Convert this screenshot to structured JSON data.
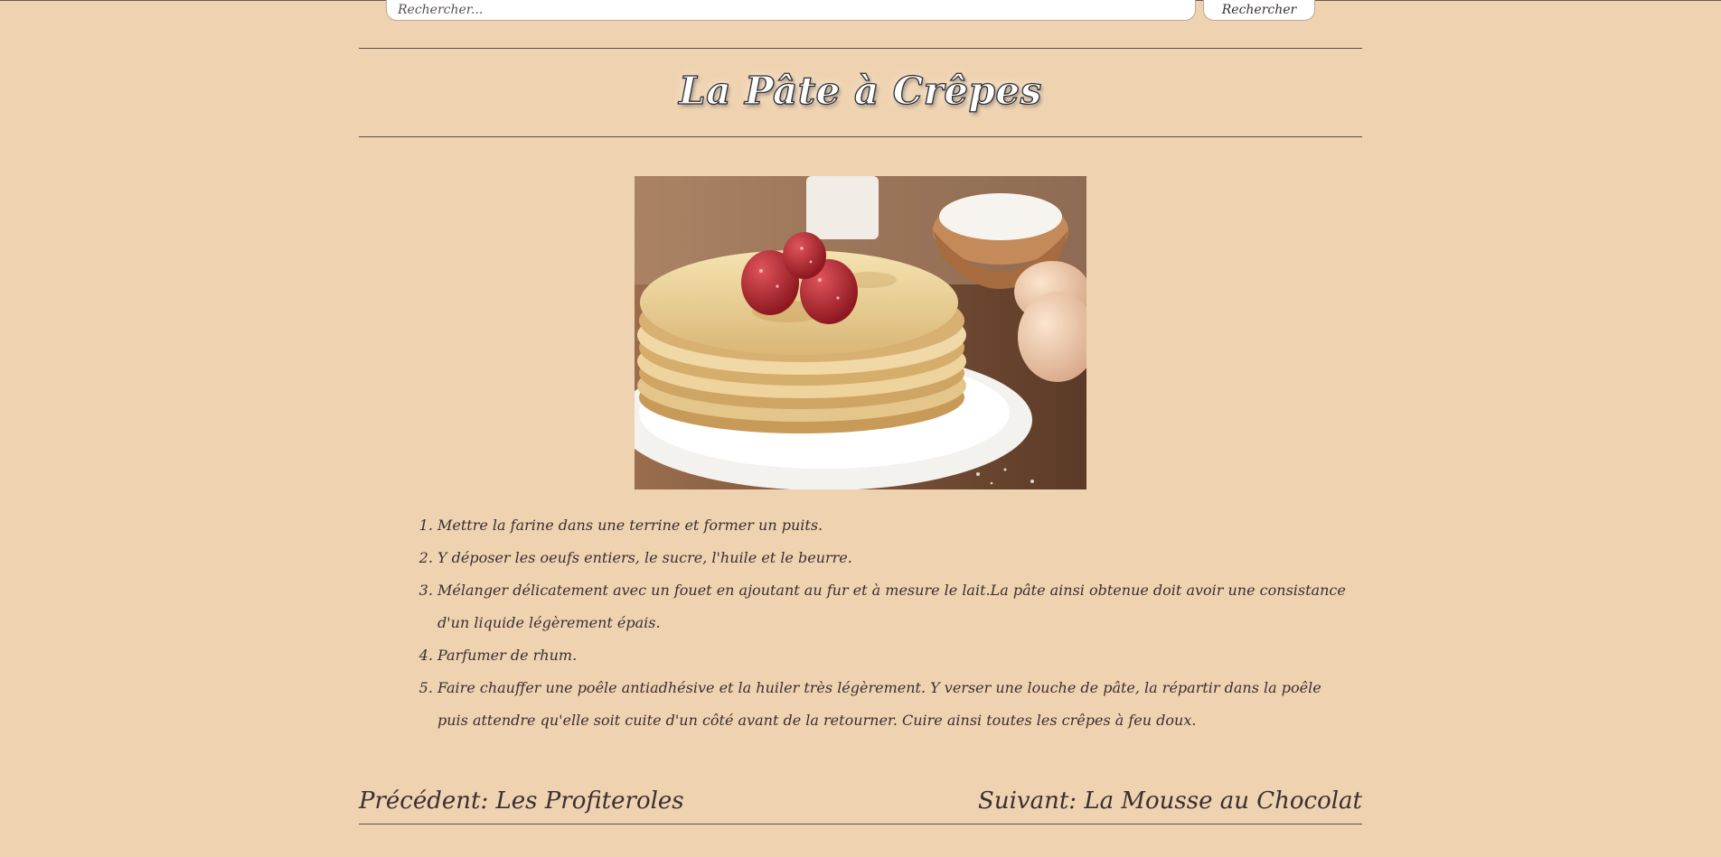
{
  "search": {
    "placeholder": "Rechercher...",
    "button_label": "Rechercher"
  },
  "page": {
    "title": "La Pâte à Crêpes",
    "image_description_icon": "crepes-photo"
  },
  "steps": [
    "Mettre la farine dans une terrine et former un puits.",
    "Y déposer les oeufs entiers, le sucre, l'huile et le beurre.",
    "Mélanger délicatement avec un fouet en ajoutant au fur et à mesure le lait.La pâte ainsi obtenue doit avoir une consistance d'un liquide légèrement épais.",
    "Parfumer de rhum.",
    "Faire chauffer une poêle antiadhésive et la huiler très légèrement. Y verser une louche de pâte, la répartir dans la poêle puis attendre qu'elle soit cuite d'un côté avant de la retourner. Cuire ainsi toutes les crêpes à feu doux."
  ],
  "navigation": {
    "previous": "Précédent: Les Profiteroles",
    "next": "Suivant: La Mousse au Chocolat"
  },
  "colors": {
    "background": "#efd2af",
    "text": "#3a2f33",
    "rule": "#5a4e48"
  }
}
